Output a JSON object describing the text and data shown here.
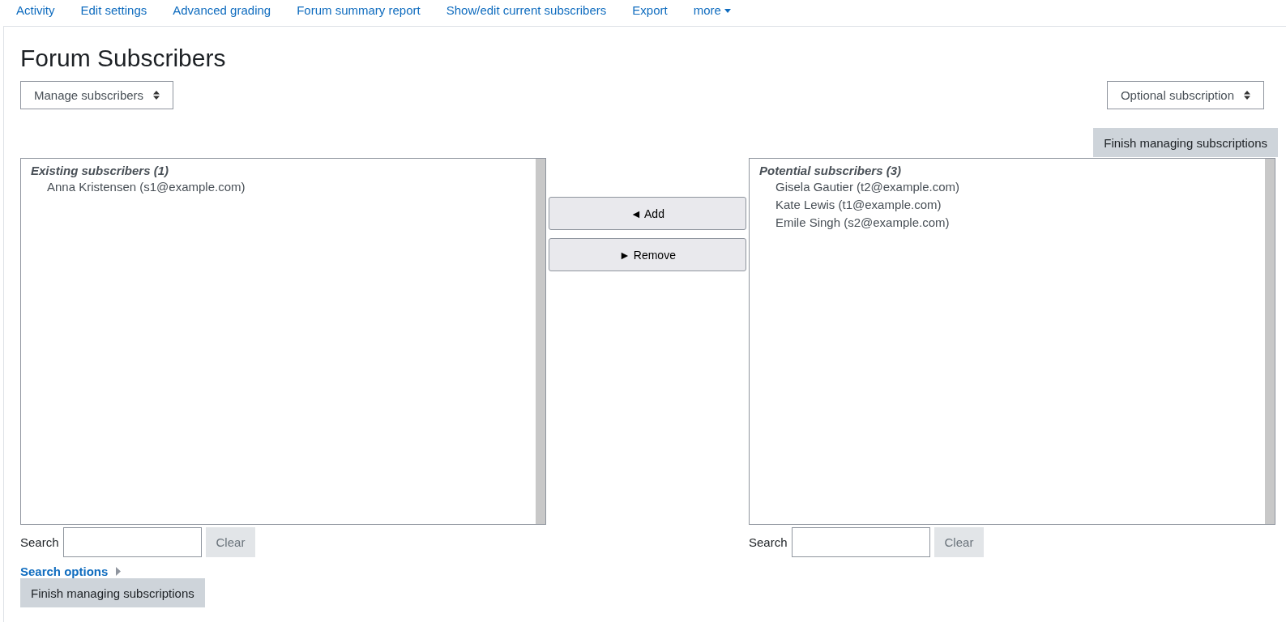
{
  "nav": [
    {
      "label": "Activity"
    },
    {
      "label": "Edit settings"
    },
    {
      "label": "Advanced grading"
    },
    {
      "label": "Forum summary report"
    },
    {
      "label": "Show/edit current subscribers"
    },
    {
      "label": "Export"
    },
    {
      "label": "more",
      "dropdown": true
    }
  ],
  "title": "Forum Subscribers",
  "view_select": {
    "value": "Manage subscribers"
  },
  "mode_select": {
    "value": "Optional subscription"
  },
  "finish_top": "Finish managing subscriptions",
  "existing": {
    "heading": "Existing subscribers (1)",
    "users": [
      "Anna Kristensen (s1@example.com)"
    ],
    "search_label": "Search",
    "clear": {
      "label": "Clear",
      "disabled": true
    }
  },
  "actions": [
    {
      "label": "◄ Add"
    },
    {
      "label": "► Remove"
    }
  ],
  "potential": {
    "heading": "Potential subscribers (3)",
    "users": [
      "Gisela Gautier (t2@example.com)",
      "Kate Lewis (t1@example.com)",
      "Emile Singh (s2@example.com)"
    ],
    "search_label": "Search",
    "clear": {
      "label": "Clear",
      "disabled": true
    }
  },
  "search_options": "Search options",
  "finish_bottom": "Finish managing subscriptions"
}
